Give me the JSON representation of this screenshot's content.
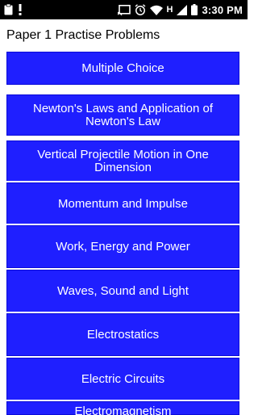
{
  "status_bar": {
    "icons_left": [
      "clipboard-icon",
      "exclamation-icon"
    ],
    "icons_right": [
      "cast-icon",
      "alarm-icon",
      "wifi-icon",
      "signal-icon",
      "battery-icon"
    ],
    "network_label": "H",
    "time": "3:30 PM"
  },
  "app": {
    "title": "Paper 1 Practise Problems"
  },
  "menu": {
    "items": [
      {
        "label": "Multiple Choice"
      },
      {
        "label": "Newton's Laws and Application of Newton's Law"
      },
      {
        "label": "Vertical Projectile Motion in One Dimension"
      },
      {
        "label": "Momentum and Impulse"
      },
      {
        "label": "Work, Energy and Power"
      },
      {
        "label": "Waves, Sound and Light"
      },
      {
        "label": "Electrostatics"
      },
      {
        "label": "Electric Circuits"
      },
      {
        "label": "Electromagnetism"
      }
    ]
  },
  "colors": {
    "status_bar_bg": "#000000",
    "button_bg": "#1f1fff",
    "button_text": "#ffffff",
    "page_bg": "#ffffff"
  }
}
